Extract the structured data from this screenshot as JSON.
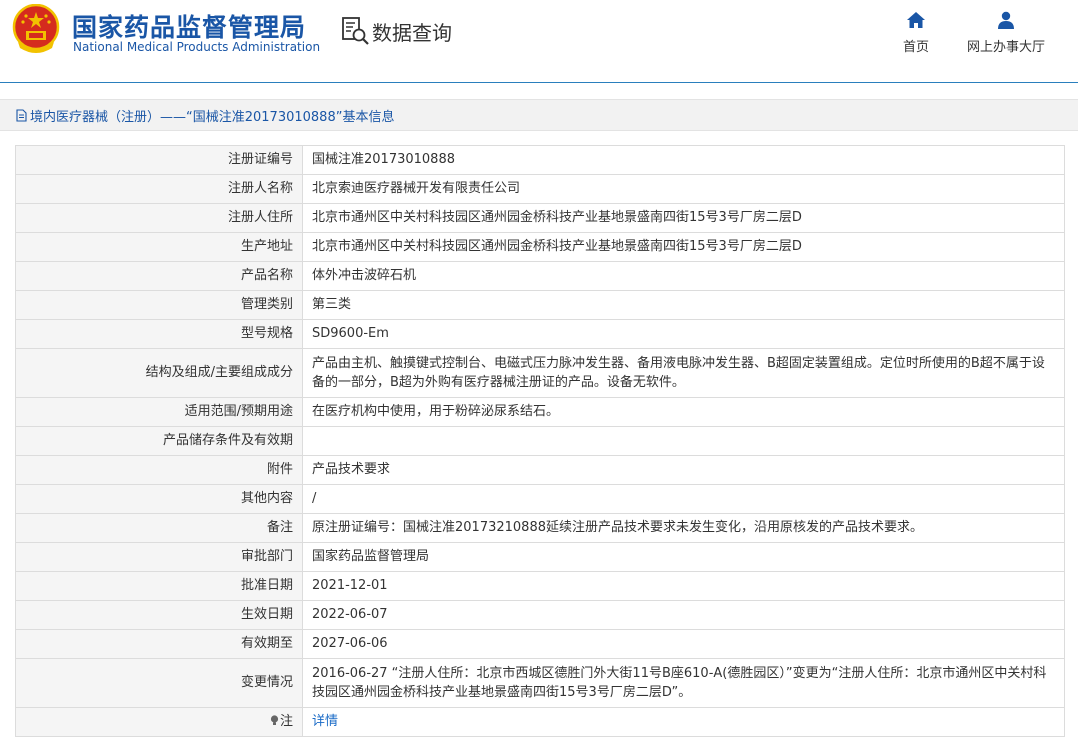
{
  "header": {
    "brand_cn": "国家药品监督管理局",
    "brand_en": "National Medical Products Administration",
    "search_title": "数据查询",
    "nav_home": "首页",
    "nav_hall": "网上办事大厅"
  },
  "section": {
    "title": "境内医疗器械（注册）——“国械注准20173010888”基本信息"
  },
  "rows": [
    {
      "label": "注册证编号",
      "value": "国械注准20173010888"
    },
    {
      "label": "注册人名称",
      "value": "北京索迪医疗器械开发有限责任公司"
    },
    {
      "label": "注册人住所",
      "value": "北京市通州区中关村科技园区通州园金桥科技产业基地景盛南四街15号3号厂房二层D"
    },
    {
      "label": "生产地址",
      "value": "北京市通州区中关村科技园区通州园金桥科技产业基地景盛南四街15号3号厂房二层D"
    },
    {
      "label": "产品名称",
      "value": "体外冲击波碎石机"
    },
    {
      "label": "管理类别",
      "value": "第三类"
    },
    {
      "label": "型号规格",
      "value": "SD9600-Em"
    },
    {
      "label": "结构及组成/主要组成成分",
      "value": "产品由主机、触摸键式控制台、电磁式压力脉冲发生器、备用液电脉冲发生器、B超固定装置组成。定位时所使用的B超不属于设备的一部分，B超为外购有医疗器械注册证的产品。设备无软件。"
    },
    {
      "label": "适用范围/预期用途",
      "value": "在医疗机构中使用，用于粉碎泌尿系结石。"
    },
    {
      "label": "产品储存条件及有效期",
      "value": ""
    },
    {
      "label": "附件",
      "value": "产品技术要求"
    },
    {
      "label": "其他内容",
      "value": "/"
    },
    {
      "label": "备注",
      "value": "原注册证编号：国械注准20173210888延续注册产品技术要求未发生变化，沿用原核发的产品技术要求。"
    },
    {
      "label": "审批部门",
      "value": "国家药品监督管理局"
    },
    {
      "label": "批准日期",
      "value": "2021-12-01"
    },
    {
      "label": "生效日期",
      "value": "2022-06-07"
    },
    {
      "label": "有效期至",
      "value": "2027-06-06"
    },
    {
      "label": "变更情况",
      "value": "2016-06-27 “注册人住所：北京市西城区德胜门外大街11号B座610-A(德胜园区）”变更为“注册人住所：北京市通州区中关村科技园区通州园金桥科技产业基地景盛南四街15号3号厂房二层D”。"
    }
  ],
  "note": {
    "label": "注",
    "link": "详情"
  },
  "icons": {
    "emblem": "national-emblem-icon",
    "search": "document-search-icon",
    "home": "home-icon",
    "hall": "user-icon",
    "page": "page-icon",
    "bulb": "lightbulb-icon"
  },
  "colors": {
    "brand_blue": "#1a56a6",
    "link_blue": "#1a6bc7",
    "label_bg": "#f5f5f5",
    "emblem_red": "#d52b1e",
    "emblem_gold": "#f2c200"
  }
}
